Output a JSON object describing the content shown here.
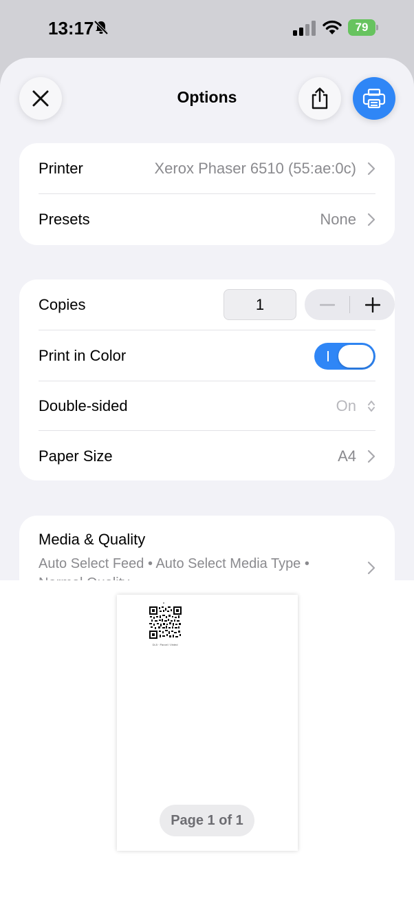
{
  "status_bar": {
    "time": "13:17",
    "battery": "79"
  },
  "header": {
    "title": "Options"
  },
  "printer_card": {
    "printer_label": "Printer",
    "printer_value": "Xerox Phaser 6510 (55:ae:0c)",
    "presets_label": "Presets",
    "presets_value": "None"
  },
  "settings_card": {
    "copies_label": "Copies",
    "copies_value": "1",
    "color_label": "Print in Color",
    "color_on": true,
    "double_sided_label": "Double-sided",
    "double_sided_value": "On",
    "paper_size_label": "Paper Size",
    "paper_size_value": "A4"
  },
  "media_card": {
    "title": "Media & Quality",
    "subtitle": "Auto Select Feed • Auto Select Media Type • Normal Quality"
  },
  "preview": {
    "page_caption": "DL5 · Parcel / Vinted",
    "page_indicator": "Page 1 of 1"
  },
  "colors": {
    "accent": "#2f86f6",
    "battery": "#67c35f"
  }
}
